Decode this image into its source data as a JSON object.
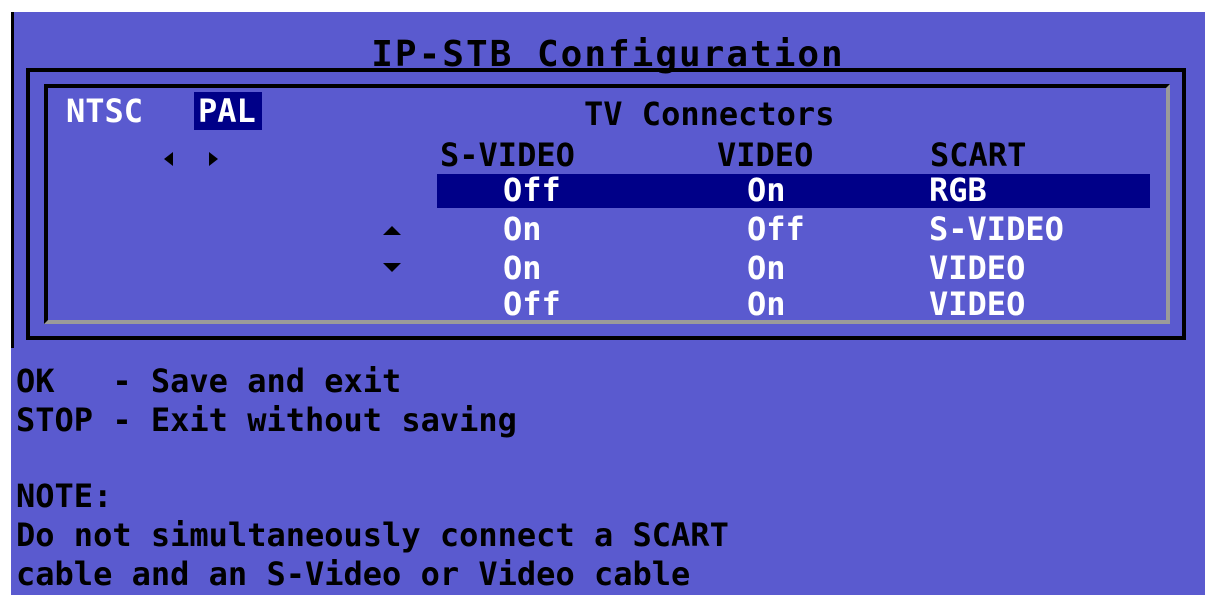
{
  "title": "IP-STB Configuration",
  "video_standard": {
    "options": [
      "NTSC",
      "PAL"
    ],
    "selected": "PAL"
  },
  "connectors": {
    "heading": "TV Connectors",
    "columns": [
      "S-VIDEO",
      "VIDEO",
      "SCART"
    ],
    "rows": [
      [
        "Off",
        "On",
        "RGB"
      ],
      [
        "On",
        "Off",
        "S-VIDEO"
      ],
      [
        "On",
        "On",
        "VIDEO"
      ],
      [
        "Off",
        "On",
        "VIDEO"
      ]
    ],
    "selected_row": 0
  },
  "help": {
    "ok": "OK   - Save and exit",
    "stop": "STOP - Exit without saving",
    "note_label": "NOTE:",
    "note_line1": "Do not simultaneously connect a SCART",
    "note_line2": "cable and an S-Video or Video cable"
  },
  "colors": {
    "background": "#5a5acf",
    "highlight": "#000088",
    "text_normal": "#000000",
    "text_selected": "#ffffff"
  },
  "icons": [
    "arrow-left-icon",
    "arrow-right-icon",
    "arrow-up-icon",
    "arrow-down-icon"
  ]
}
